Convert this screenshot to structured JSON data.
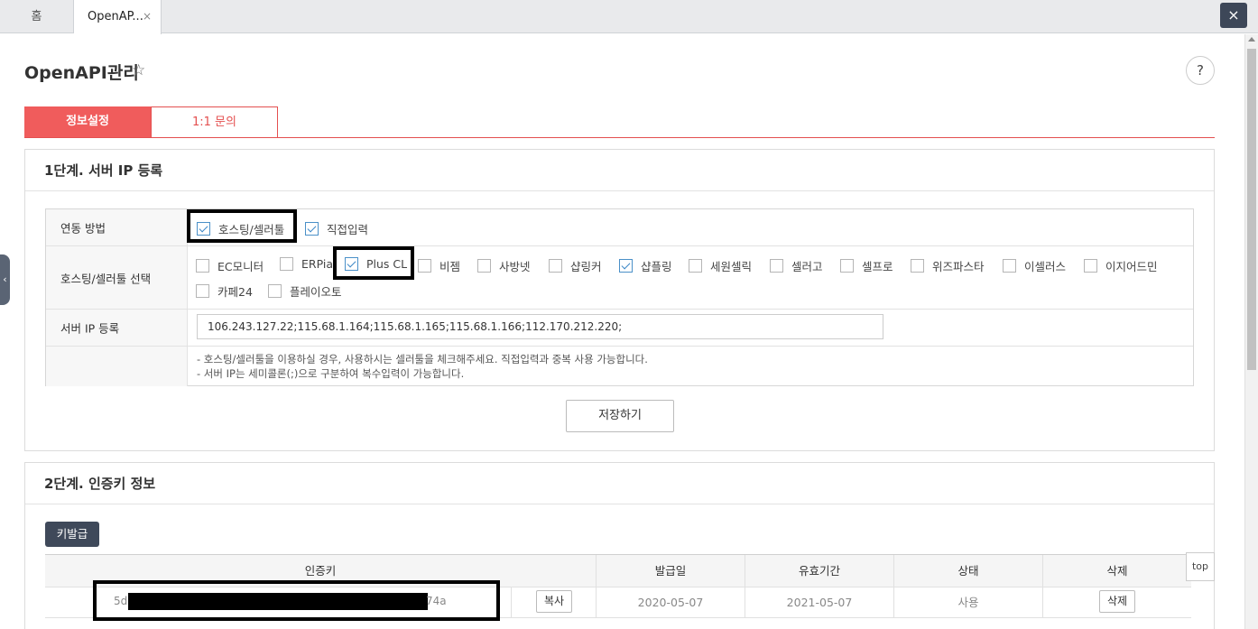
{
  "tabs": {
    "home": "홈",
    "active": "OpenAP...",
    "close": "×"
  },
  "window": {
    "close": "×"
  },
  "page": {
    "title": "OpenAPI관리",
    "help": "?"
  },
  "section_tabs": {
    "info": "정보설정",
    "inquiry": "1:1 문의"
  },
  "step1": {
    "title": "1단계. 서버 IP 등록",
    "rows": {
      "method": "연동 방법",
      "tool_select": "호스팅/셀러툴 선택",
      "server_ip": "서버 IP 등록"
    },
    "methods": [
      {
        "label": "호스팅/셀러툴",
        "checked": true
      },
      {
        "label": "직접입력",
        "checked": true
      }
    ],
    "tools": [
      {
        "label": "EC모니터",
        "checked": false
      },
      {
        "label": "ERPia",
        "checked": false
      },
      {
        "label": "Plus CL",
        "checked": true
      },
      {
        "label": "비젬",
        "checked": false
      },
      {
        "label": "사방넷",
        "checked": false
      },
      {
        "label": "샵링커",
        "checked": false
      },
      {
        "label": "샵플링",
        "checked": true
      },
      {
        "label": "세원셀릭",
        "checked": false
      },
      {
        "label": "셀러고",
        "checked": false
      },
      {
        "label": "셀프로",
        "checked": false
      },
      {
        "label": "위즈파스타",
        "checked": false
      },
      {
        "label": "이셀러스",
        "checked": false
      },
      {
        "label": "이지어드민",
        "checked": false
      },
      {
        "label": "카페24",
        "checked": false
      },
      {
        "label": "플레이오토",
        "checked": false
      }
    ],
    "ip_value": "106.243.127.22;115.68.1.164;115.68.1.165;115.68.1.166;112.170.212.220;",
    "notes": [
      "- 호스팅/셀러툴을 이용하실 경우, 사용하시는 셀러툴을 체크해주세요. 직접입력과 중복 사용 가능합니다.",
      "- 서버 IP는 세미콜론(;)으로 구분하여 복수입력이 가능합니다."
    ],
    "save": "저장하기"
  },
  "step2": {
    "title": "2단계. 인증키 정보",
    "issue_button": "키발급",
    "columns": [
      "인증키",
      "발급일",
      "유효기간",
      "상태",
      "삭제"
    ],
    "row": {
      "key_prefix": "5d",
      "key_suffix": "74a",
      "copy": "복사",
      "issued": "2020-05-07",
      "expires": "2021-05-07",
      "status": "사용",
      "delete": "삭제"
    }
  },
  "top_button": "top"
}
